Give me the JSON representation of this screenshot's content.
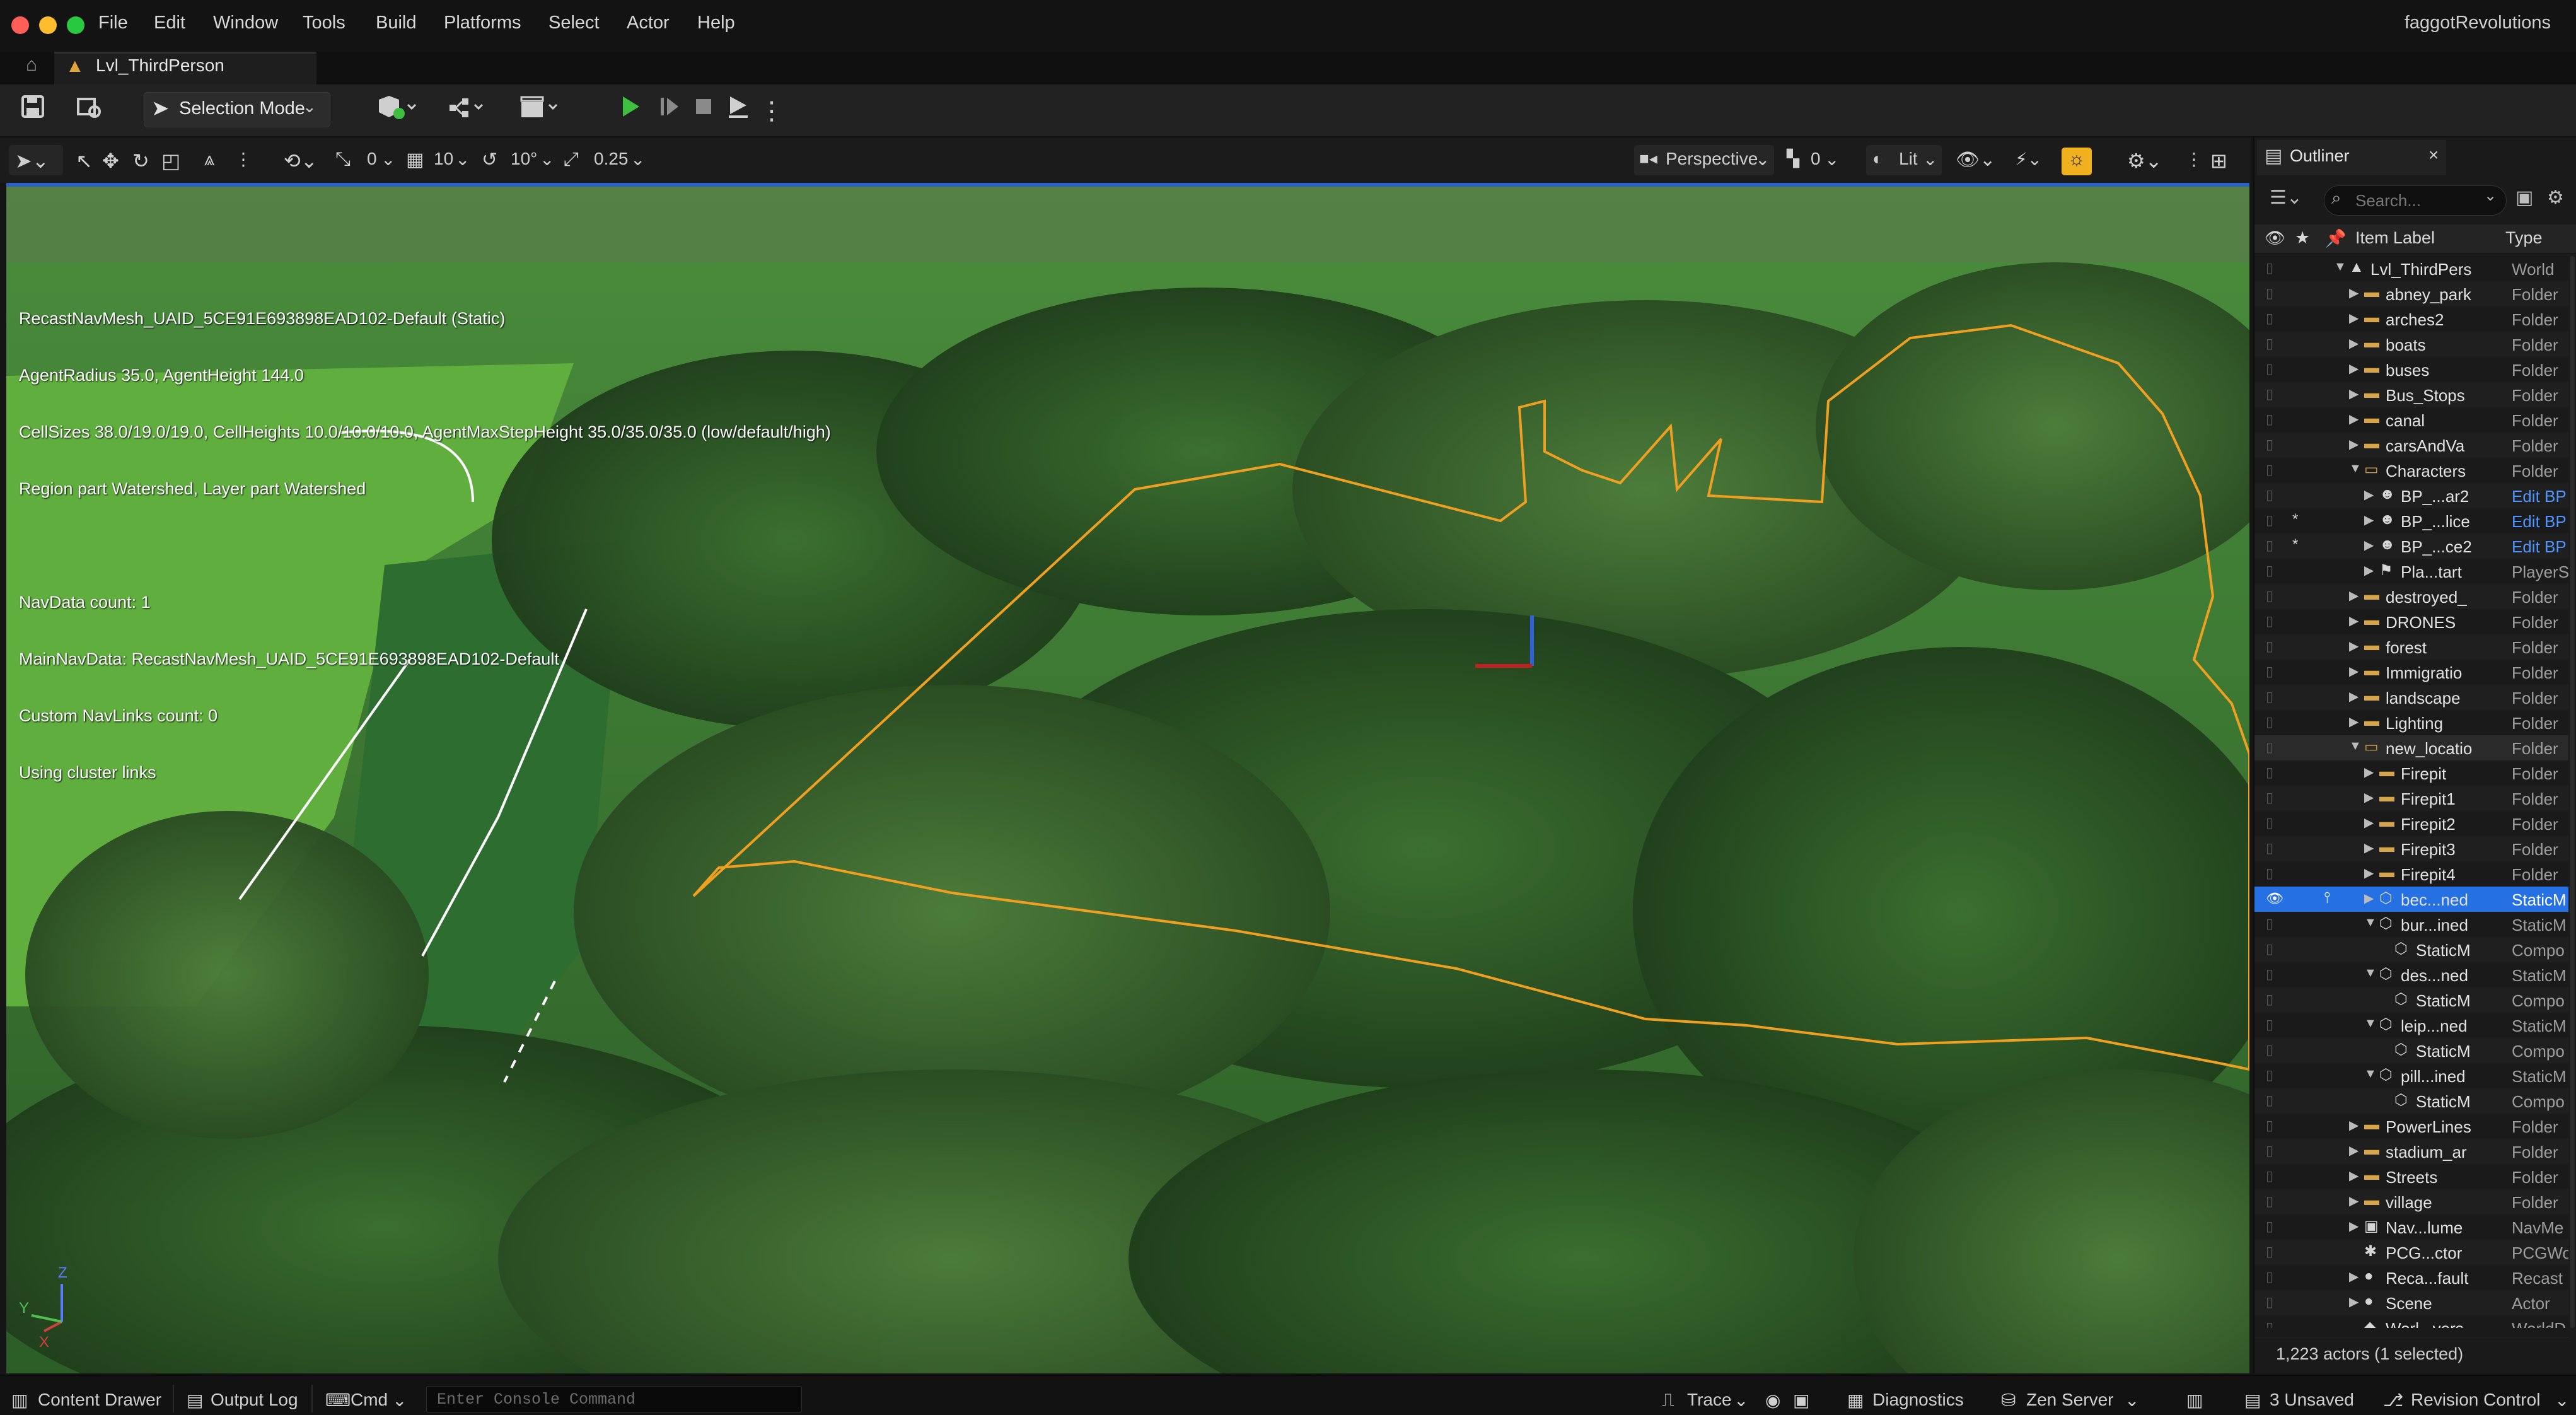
{
  "menubar": {
    "items": [
      "File",
      "Edit",
      "Window",
      "Tools",
      "Build",
      "Platforms",
      "Select",
      "Actor",
      "Help"
    ],
    "project_name": "faggotRevolutions"
  },
  "tab": {
    "label": "Lvl_ThirdPerson"
  },
  "toolbar": {
    "selection_mode": "Selection Mode"
  },
  "viewport_toolbar": {
    "rotate_snap_small": "0",
    "grid_snap": "10",
    "rotation_snap": "10°",
    "scale_snap": "0.25",
    "view_mode": "Perspective",
    "camera_speed": "0",
    "lit_mode": "Lit"
  },
  "stats": {
    "lines": [
      "RecastNavMesh_UAID_5CE91E693898EAD102-Default (Static)",
      "AgentRadius 35.0, AgentHeight 144.0",
      "CellSizes 38.0/19.0/19.0, CellHeights 10.0/10.0/10.0, AgentMaxStepHeight 35.0/35.0/35.0 (low/default/high)",
      "Region part Watershed, Layer part Watershed",
      "",
      "NavData count: 1",
      "MainNavData: RecastNavMesh_UAID_5CE91E693898EAD102-Default",
      "Custom NavLinks count: 0",
      "Using cluster links"
    ]
  },
  "outliner": {
    "title": "Outliner",
    "search_placeholder": "Search...",
    "col_label": "Item Label",
    "col_type": "Type",
    "rows": [
      {
        "label": "Lvl_ThirdPers",
        "type": "World",
        "depth": 0,
        "kind": "world",
        "arrow": "down"
      },
      {
        "label": "abney_park",
        "type": "Folder",
        "depth": 1,
        "kind": "folder",
        "arrow": "right"
      },
      {
        "label": "arches2",
        "type": "Folder",
        "depth": 1,
        "kind": "folder",
        "arrow": "right"
      },
      {
        "label": "boats",
        "type": "Folder",
        "depth": 1,
        "kind": "folder",
        "arrow": "right"
      },
      {
        "label": "buses",
        "type": "Folder",
        "depth": 1,
        "kind": "folder",
        "arrow": "right"
      },
      {
        "label": "Bus_Stops",
        "type": "Folder",
        "depth": 1,
        "kind": "folder",
        "arrow": "right"
      },
      {
        "label": "canal",
        "type": "Folder",
        "depth": 1,
        "kind": "folder",
        "arrow": "right"
      },
      {
        "label": "carsAndVa",
        "type": "Folder",
        "depth": 1,
        "kind": "folder",
        "arrow": "right"
      },
      {
        "label": "Characters",
        "type": "Folder",
        "depth": 1,
        "kind": "folder-open",
        "arrow": "down"
      },
      {
        "label": "BP_...ar2",
        "type": "Edit BP",
        "depth": 2,
        "kind": "char",
        "arrow": "right",
        "link": true
      },
      {
        "label": "BP_...lice",
        "type": "Edit BP",
        "depth": 2,
        "kind": "char",
        "arrow": "right",
        "link": true,
        "star": true
      },
      {
        "label": "BP_...ce2",
        "type": "Edit BP",
        "depth": 2,
        "kind": "char",
        "arrow": "right",
        "link": true,
        "star": true
      },
      {
        "label": "Pla...tart",
        "type": "PlayerS",
        "depth": 2,
        "kind": "player",
        "arrow": "right"
      },
      {
        "label": "destroyed_",
        "type": "Folder",
        "depth": 1,
        "kind": "folder",
        "arrow": "right"
      },
      {
        "label": "DRONES",
        "type": "Folder",
        "depth": 1,
        "kind": "folder",
        "arrow": "right"
      },
      {
        "label": "forest",
        "type": "Folder",
        "depth": 1,
        "kind": "folder",
        "arrow": "right"
      },
      {
        "label": "Immigratio",
        "type": "Folder",
        "depth": 1,
        "kind": "folder",
        "arrow": "right"
      },
      {
        "label": "landscape",
        "type": "Folder",
        "depth": 1,
        "kind": "folder",
        "arrow": "right"
      },
      {
        "label": "Lighting",
        "type": "Folder",
        "depth": 1,
        "kind": "folder",
        "arrow": "right"
      },
      {
        "label": "new_locatio",
        "type": "Folder",
        "depth": 1,
        "kind": "folder-open",
        "arrow": "down",
        "highlight": true
      },
      {
        "label": "Firepit",
        "type": "Folder",
        "depth": 2,
        "kind": "folder",
        "arrow": "right"
      },
      {
        "label": "Firepit1",
        "type": "Folder",
        "depth": 2,
        "kind": "folder",
        "arrow": "right"
      },
      {
        "label": "Firepit2",
        "type": "Folder",
        "depth": 2,
        "kind": "folder",
        "arrow": "right"
      },
      {
        "label": "Firepit3",
        "type": "Folder",
        "depth": 2,
        "kind": "folder",
        "arrow": "right"
      },
      {
        "label": "Firepit4",
        "type": "Folder",
        "depth": 2,
        "kind": "folder",
        "arrow": "right"
      },
      {
        "label": "bec...ned",
        "type": "StaticM",
        "depth": 2,
        "kind": "mesh",
        "arrow": "right",
        "selected": true
      },
      {
        "label": "bur...ined",
        "type": "StaticM",
        "depth": 2,
        "kind": "mesh",
        "arrow": "down"
      },
      {
        "label": "StaticM",
        "type": "Compo",
        "depth": 3,
        "kind": "mesh",
        "arrow": ""
      },
      {
        "label": "des...ned",
        "type": "StaticM",
        "depth": 2,
        "kind": "mesh",
        "arrow": "down"
      },
      {
        "label": "StaticM",
        "type": "Compo",
        "depth": 3,
        "kind": "mesh",
        "arrow": ""
      },
      {
        "label": "leip...ned",
        "type": "StaticM",
        "depth": 2,
        "kind": "mesh",
        "arrow": "down"
      },
      {
        "label": "StaticM",
        "type": "Compo",
        "depth": 3,
        "kind": "mesh",
        "arrow": ""
      },
      {
        "label": "pill...ined",
        "type": "StaticM",
        "depth": 2,
        "kind": "mesh",
        "arrow": "down"
      },
      {
        "label": "StaticM",
        "type": "Compo",
        "depth": 3,
        "kind": "mesh",
        "arrow": ""
      },
      {
        "label": "PowerLines",
        "type": "Folder",
        "depth": 1,
        "kind": "folder",
        "arrow": "right"
      },
      {
        "label": "stadium_ar",
        "type": "Folder",
        "depth": 1,
        "kind": "folder",
        "arrow": "right"
      },
      {
        "label": "Streets",
        "type": "Folder",
        "depth": 1,
        "kind": "folder",
        "arrow": "right"
      },
      {
        "label": "village",
        "type": "Folder",
        "depth": 1,
        "kind": "folder",
        "arrow": "right"
      },
      {
        "label": "Nav...lume",
        "type": "NavMe",
        "depth": 1,
        "kind": "nav",
        "arrow": "right"
      },
      {
        "label": "PCG...ctor",
        "type": "PCGWo",
        "depth": 1,
        "kind": "pcg",
        "arrow": ""
      },
      {
        "label": "Reca...fault",
        "type": "Recast",
        "depth": 1,
        "kind": "recast",
        "arrow": "right"
      },
      {
        "label": "Scene",
        "type": "Actor",
        "depth": 1,
        "kind": "scene",
        "arrow": "right"
      },
      {
        "label": "Worl...vers",
        "type": "WorldD",
        "depth": 1,
        "kind": "worldd",
        "arrow": ""
      }
    ],
    "footer": "1,223 actors (1 selected)"
  },
  "statusbar": {
    "content_drawer": "Content Drawer",
    "output_log": "Output Log",
    "cmd": "Cmd",
    "console_placeholder": "Enter Console Command",
    "trace": "Trace",
    "diagnostics": "Diagnostics",
    "zen_server": "Zen Server",
    "unsaved": "3 Unsaved",
    "revision_control": "Revision Control"
  },
  "colors": {
    "accent_blue": "#2570e3",
    "folder": "#d7a64a",
    "play_green": "#3fbf3f",
    "selection_outline": "#f0a020",
    "lighting_toggle": "#f0b020"
  }
}
